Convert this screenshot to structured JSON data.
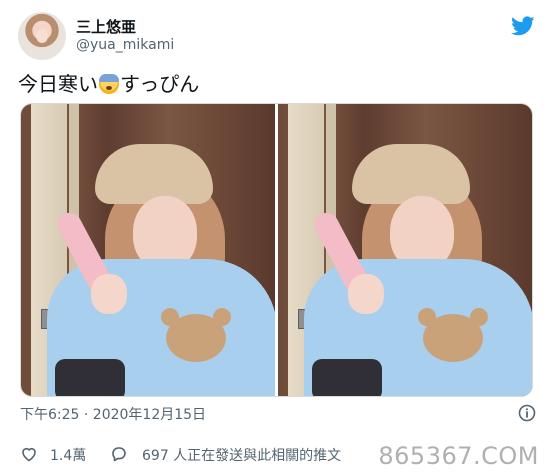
{
  "user": {
    "display_name": "三上悠亜",
    "handle": "@yua_mikami"
  },
  "tweet": {
    "text_before_emoji": "今日寒い",
    "emoji_name": "anxious-face-with-sweat-emoji",
    "text_after_emoji": "すっぴん"
  },
  "meta": {
    "timestamp": "下午6:25 · 2020年12月15日"
  },
  "actions": {
    "likes": "1.4萬",
    "replies": "697 人正在發送與此相關的推文"
  },
  "watermark": {
    "text": "865367.COM"
  },
  "icons": {
    "brand": "twitter-bird-icon",
    "info": "info-circle-icon",
    "like": "heart-icon",
    "reply": "reply-bubble-icon"
  },
  "colors": {
    "twitter_blue": "#1d9bf0",
    "muted_text": "#536471"
  }
}
